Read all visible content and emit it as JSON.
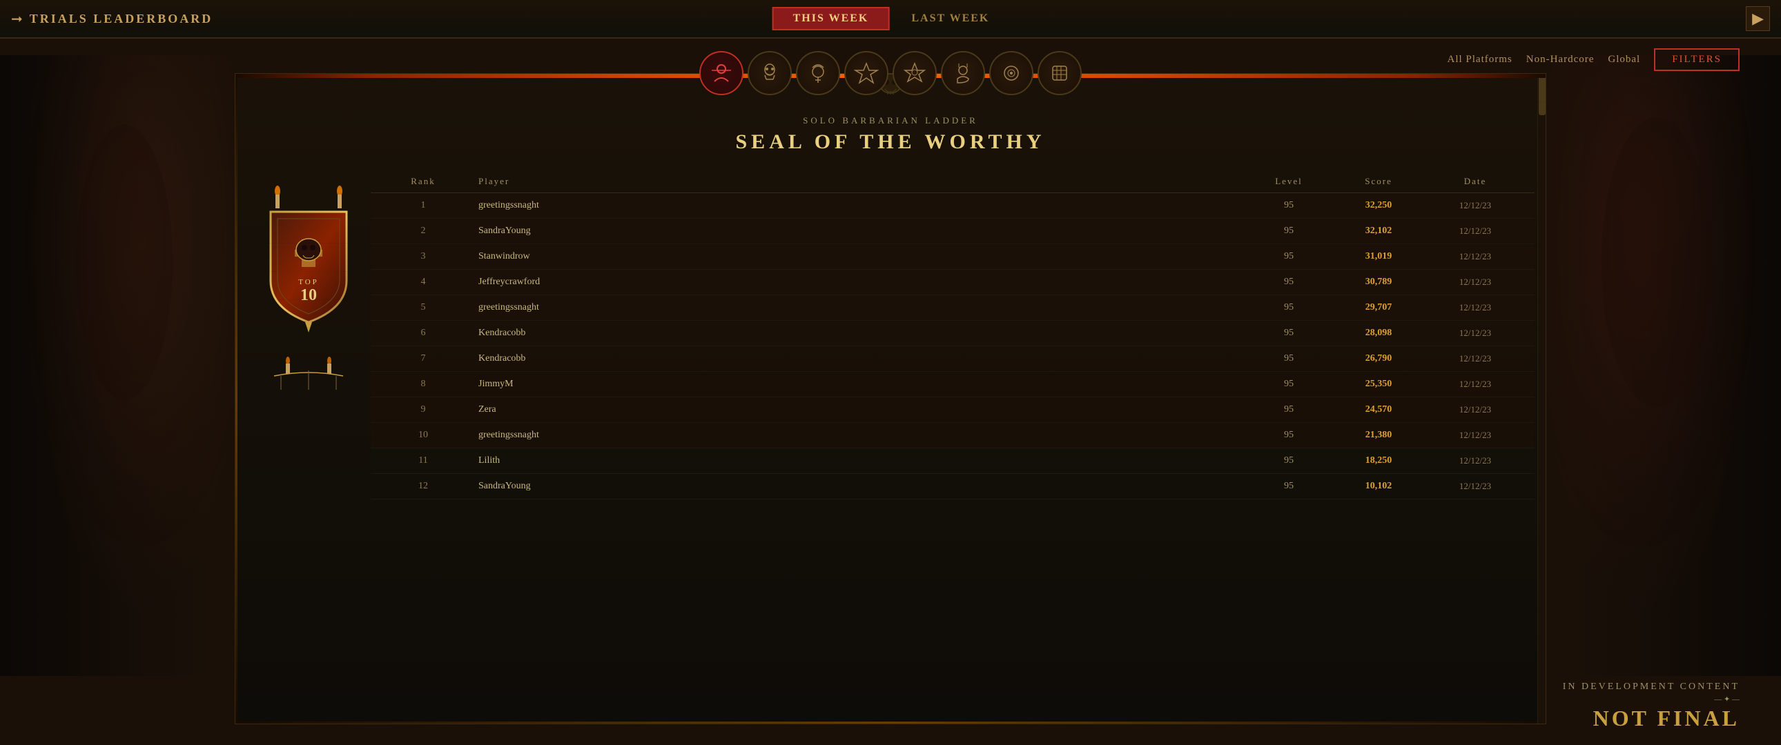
{
  "topBar": {
    "title": "TRIALS LEADERBOARD",
    "thisWeekLabel": "THIS WEEK",
    "lastWeekLabel": "LAST WEEK",
    "activeTab": "this_week"
  },
  "classIcons": [
    {
      "name": "barbarian",
      "selected": true,
      "symbol": "⚔"
    },
    {
      "name": "necromancer",
      "selected": false,
      "symbol": "💀"
    },
    {
      "name": "druid",
      "selected": false,
      "symbol": "🐺"
    },
    {
      "name": "sorcerer",
      "selected": false,
      "symbol": "🔮"
    },
    {
      "name": "rogue",
      "selected": false,
      "symbol": "🗡"
    },
    {
      "name": "unknown1",
      "selected": false,
      "symbol": "☠"
    },
    {
      "name": "unknown2",
      "selected": false,
      "symbol": "⚙"
    },
    {
      "name": "unknown3",
      "selected": false,
      "symbol": "✦"
    }
  ],
  "filterArea": {
    "platform": "All Platforms",
    "mode": "Non-Hardcore",
    "scope": "Global",
    "filterBtnLabel": "Filters"
  },
  "ladder": {
    "subtitle": "SOLO BARBARIAN LADDER",
    "title": "SEAL OF THE WORTHY"
  },
  "tableHeaders": {
    "rank": "Rank",
    "player": "Player",
    "level": "Level",
    "score": "Score",
    "date": "Date"
  },
  "leaderboard": [
    {
      "rank": "1",
      "player": "greetingssnaght",
      "level": "95",
      "score": "32,250",
      "date": "12/12/23"
    },
    {
      "rank": "2",
      "player": "SandraYoung",
      "level": "95",
      "score": "32,102",
      "date": "12/12/23"
    },
    {
      "rank": "3",
      "player": "Stanwindrow",
      "level": "95",
      "score": "31,019",
      "date": "12/12/23"
    },
    {
      "rank": "4",
      "player": "Jeffreycrawford",
      "level": "95",
      "score": "30,789",
      "date": "12/12/23"
    },
    {
      "rank": "5",
      "player": "greetingssnaght",
      "level": "95",
      "score": "29,707",
      "date": "12/12/23"
    },
    {
      "rank": "6",
      "player": "Kendracobb",
      "level": "95",
      "score": "28,098",
      "date": "12/12/23"
    },
    {
      "rank": "7",
      "player": "Kendracobb",
      "level": "95",
      "score": "26,790",
      "date": "12/12/23"
    },
    {
      "rank": "8",
      "player": "JimmyM",
      "level": "95",
      "score": "25,350",
      "date": "12/12/23"
    },
    {
      "rank": "9",
      "player": "Zera",
      "level": "95",
      "score": "24,570",
      "date": "12/12/23"
    },
    {
      "rank": "10",
      "player": "greetingssnaght",
      "level": "95",
      "score": "21,380",
      "date": "12/12/23"
    },
    {
      "rank": "11",
      "player": "Lilith",
      "level": "95",
      "score": "18,250",
      "date": "12/12/23"
    },
    {
      "rank": "12",
      "player": "SandraYoung",
      "level": "95",
      "score": "10,102",
      "date": "12/12/23"
    }
  ],
  "badge": {
    "topLabel": "TOP",
    "topNumber": "10"
  },
  "devNotice": {
    "topLine": "IN DEVELOPMENT CONTENT",
    "bottomLine": "NOT FINAL"
  }
}
